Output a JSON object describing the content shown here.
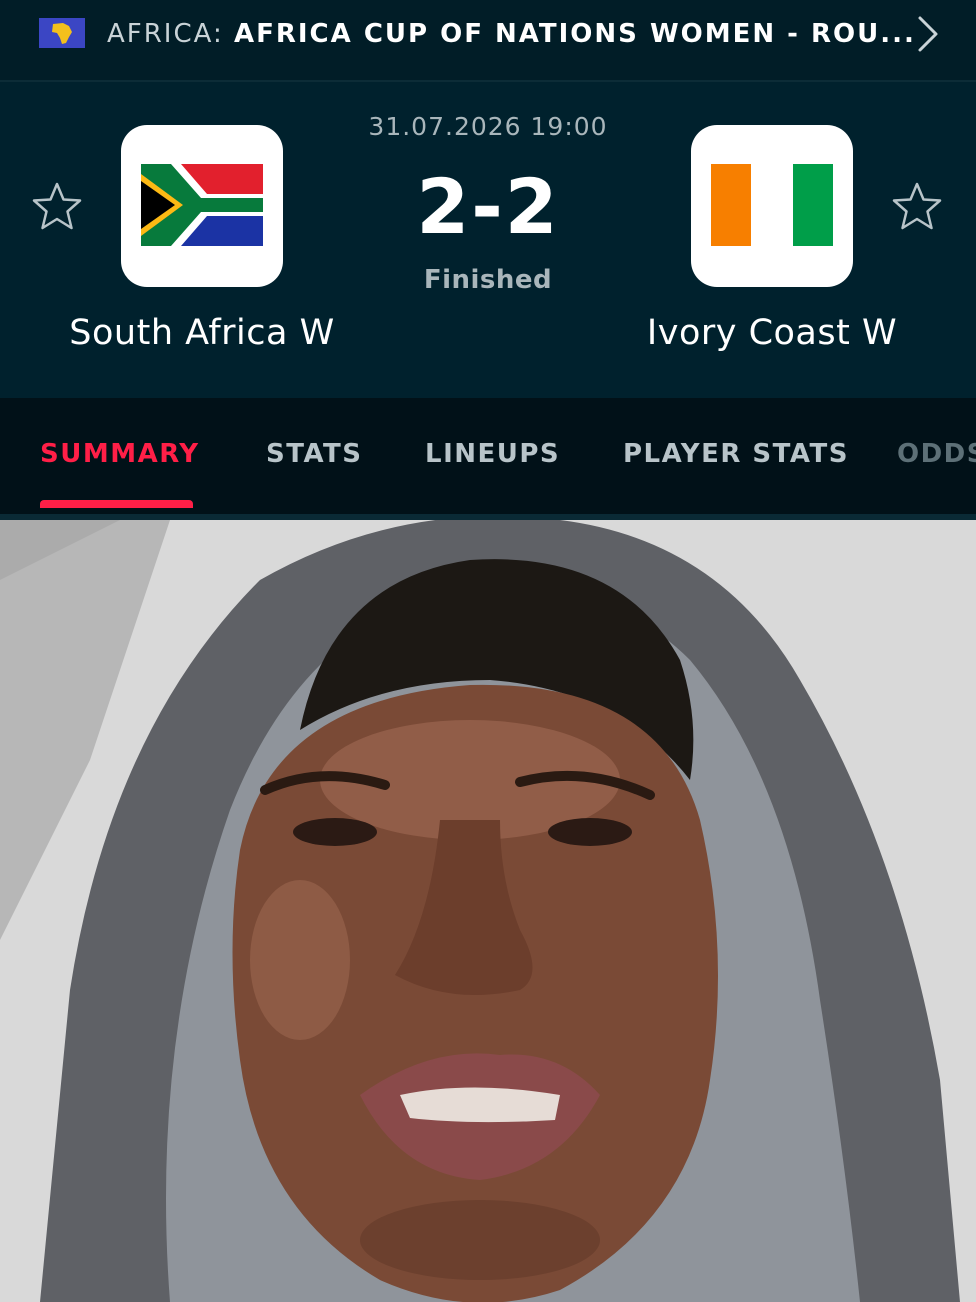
{
  "top_bar": {
    "region_flag_icon": "africa-continent-flag-icon",
    "country_label": "AFRICA:",
    "tournament_label": "AFRICA CUP OF NATIONS WOMEN - ROU...",
    "chevron_icon": "chevron-right-icon"
  },
  "match": {
    "datetime": "31.07.2026 19:00",
    "score": "2-2",
    "status": "Finished",
    "home": {
      "name": "South Africa W",
      "flag_icon": "south-africa-flag-icon",
      "favorite_icon": "star-outline-icon"
    },
    "away": {
      "name": "Ivory Coast W",
      "flag_icon": "ivory-coast-flag-icon",
      "favorite_icon": "star-outline-icon"
    }
  },
  "tabs": [
    {
      "label": "SUMMARY",
      "active": true
    },
    {
      "label": "STATS",
      "active": false
    },
    {
      "label": "LINEUPS",
      "active": false
    },
    {
      "label": "PLAYER STATS",
      "active": false
    },
    {
      "label": "ODDS",
      "active": false
    }
  ],
  "colors": {
    "background": "#00212d",
    "tab_bar": "#011118",
    "accent": "#ff1f47",
    "muted_text": "#a9b6bb"
  },
  "video": {
    "content": "webcam-person-in-grey-hood"
  }
}
